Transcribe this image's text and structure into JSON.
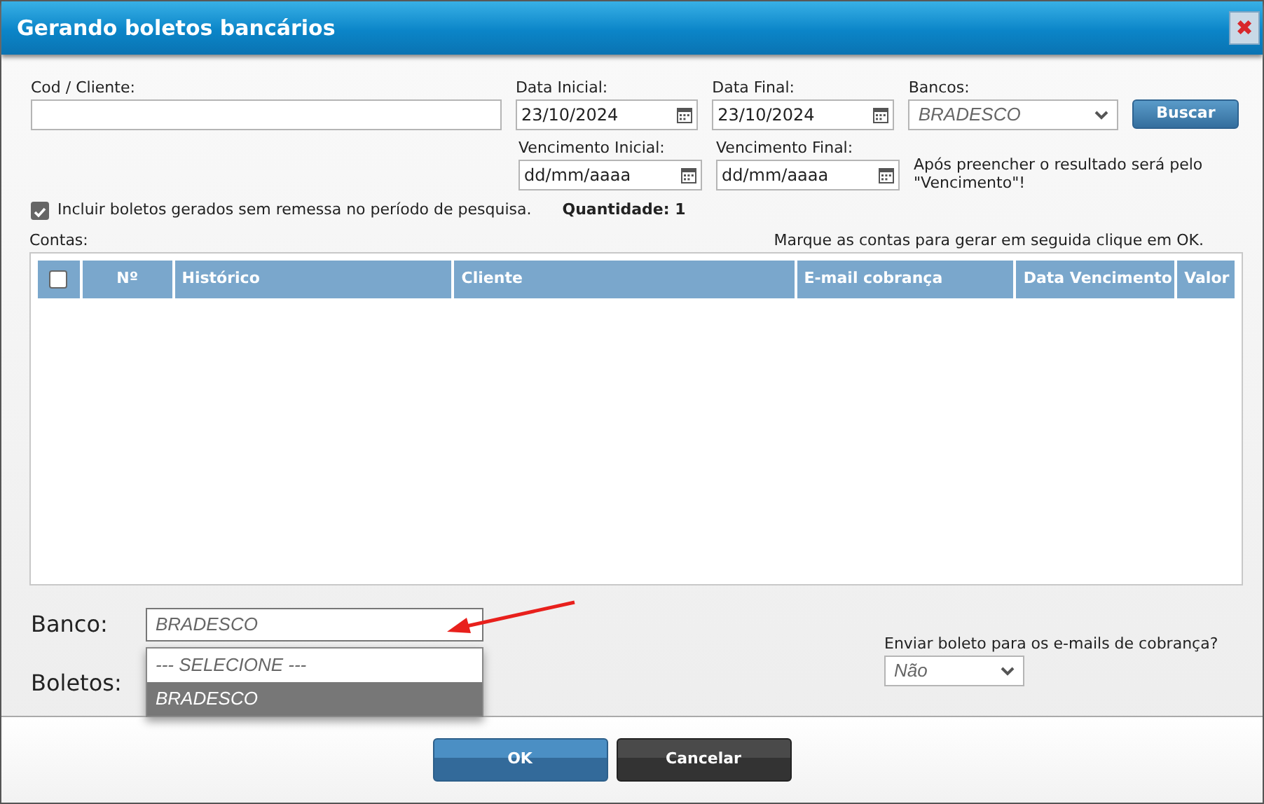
{
  "window": {
    "title": "Gerando boletos bancários",
    "close": "✖"
  },
  "filters": {
    "cod_cliente": {
      "label": "Cod / Cliente:"
    },
    "data_inicial": {
      "label": "Data Inicial:",
      "value": "23/10/2024"
    },
    "data_final": {
      "label": "Data Final:",
      "value": "23/10/2024"
    },
    "bancos": {
      "label": "Bancos:",
      "value": "BRADESCO"
    },
    "search_button": "Buscar",
    "vencimento_inicial": {
      "label": "Vencimento Inicial:",
      "value": "dd/mm/aaaa"
    },
    "vencimento_final": {
      "label": "Vencimento Final:",
      "value": "dd/mm/aaaa"
    },
    "note": "Após preencher o resultado será pelo \"Vencimento\"!"
  },
  "include_checkbox": {
    "label": "Incluir boletos gerados sem remessa no período de pesquisa.",
    "checked": true
  },
  "quantidade": "Quantidade: 1",
  "contas_label": "Contas:",
  "instruction": "Marque as contas para gerar em seguida clique em OK.",
  "table": {
    "select_all_checked": false,
    "columns": [
      "Nº",
      "Histórico",
      "Cliente",
      "E-mail cobrança",
      "Data Vencimento",
      "Valor"
    ]
  },
  "banco": {
    "label": "Banco:",
    "value": "BRADESCO",
    "options": [
      {
        "label": "--- SELECIONE ---",
        "selected": false
      },
      {
        "label": "BRADESCO",
        "selected": true
      }
    ]
  },
  "boletos_label": "Boletos:",
  "enviar": {
    "label": "Enviar boleto para os e-mails de cobrança?",
    "value": "Não"
  },
  "buttons": [
    {
      "label": "OK",
      "kind": "primary"
    },
    {
      "label": "Cancelar",
      "kind": "secondary"
    }
  ]
}
